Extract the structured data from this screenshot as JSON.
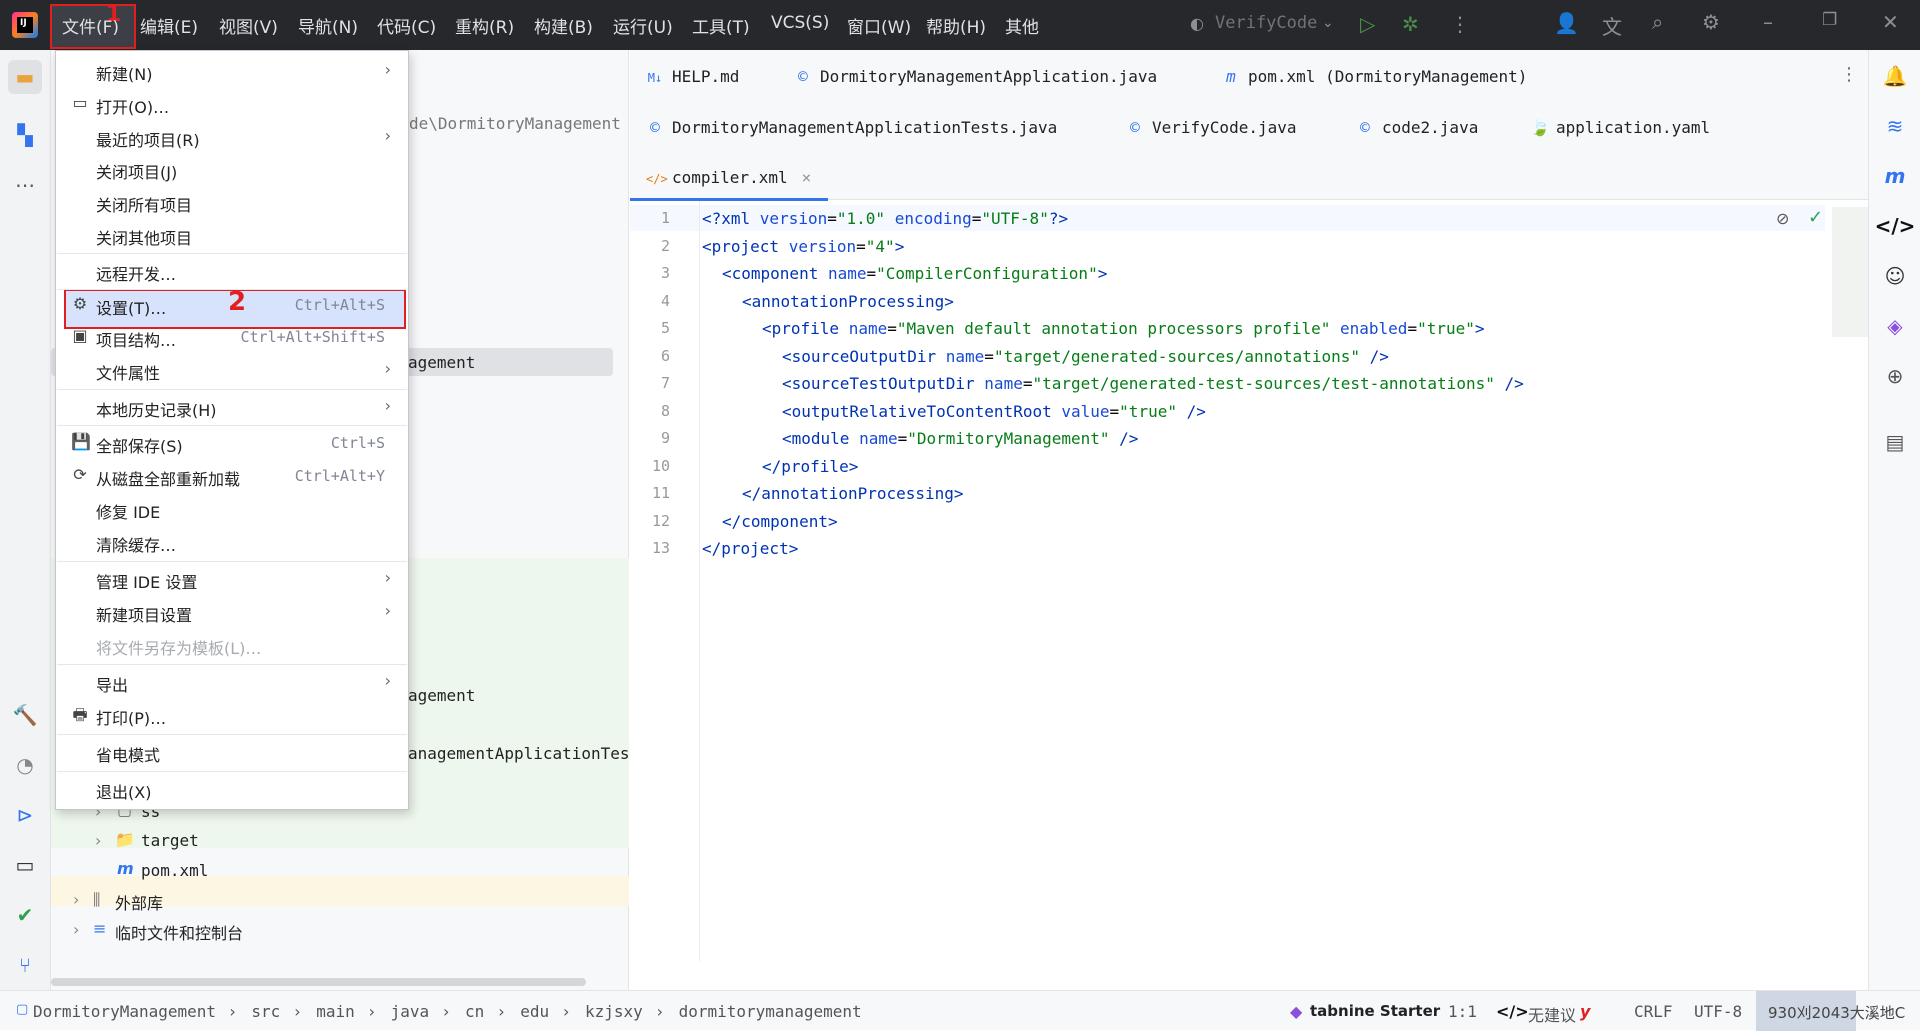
{
  "titlebar": {
    "menu": [
      "文件(F)",
      "编辑(E)",
      "视图(V)",
      "导航(N)",
      "代码(C)",
      "重构(R)",
      "构建(B)",
      "运行(U)",
      "工具(T)",
      "VCS(S)",
      "窗口(W)",
      "帮助(H)",
      "其他"
    ],
    "run_config": "VerifyCode",
    "annotation_1": "1"
  },
  "file_menu": {
    "annotation_2": "2",
    "items": [
      {
        "label": "新建(N)",
        "shortcut": "",
        "submenu": "›",
        "icon": ""
      },
      {
        "label": "打开(O)…",
        "shortcut": "",
        "submenu": "",
        "icon": "▭"
      },
      {
        "label": "最近的项目(R)",
        "shortcut": "",
        "submenu": "›",
        "icon": ""
      },
      {
        "label": "关闭项目(J)",
        "shortcut": "",
        "submenu": "",
        "icon": ""
      },
      {
        "label": "关闭所有项目",
        "shortcut": "",
        "submenu": "",
        "icon": ""
      },
      {
        "label": "关闭其他项目",
        "shortcut": "",
        "submenu": "",
        "icon": ""
      },
      {
        "label": "远程开发…",
        "shortcut": "",
        "submenu": "",
        "icon": ""
      },
      {
        "label": "设置(T)…",
        "shortcut": "Ctrl+Alt+S",
        "submenu": "",
        "icon": "⚙"
      },
      {
        "label": "项目结构…",
        "shortcut": "Ctrl+Alt+Shift+S",
        "submenu": "",
        "icon": "▣"
      },
      {
        "label": "文件属性",
        "shortcut": "",
        "submenu": "›",
        "icon": ""
      },
      {
        "label": "本地历史记录(H)",
        "shortcut": "",
        "submenu": "›",
        "icon": ""
      },
      {
        "label": "全部保存(S)",
        "shortcut": "Ctrl+S",
        "submenu": "",
        "icon": "💾"
      },
      {
        "label": "从磁盘全部重新加载",
        "shortcut": "Ctrl+Alt+Y",
        "submenu": "",
        "icon": "⟳"
      },
      {
        "label": "修复 IDE",
        "shortcut": "",
        "submenu": "",
        "icon": ""
      },
      {
        "label": "清除缓存…",
        "shortcut": "",
        "submenu": "",
        "icon": ""
      },
      {
        "label": "管理 IDE 设置",
        "shortcut": "",
        "submenu": "›",
        "icon": ""
      },
      {
        "label": "新建项目设置",
        "shortcut": "",
        "submenu": "›",
        "icon": ""
      },
      {
        "label": "将文件另存为模板(L)…",
        "shortcut": "",
        "submenu": "",
        "icon": ""
      },
      {
        "label": "导出",
        "shortcut": "",
        "submenu": "›",
        "icon": ""
      },
      {
        "label": "打印(P)…",
        "shortcut": "",
        "submenu": "",
        "icon": "🖶"
      },
      {
        "label": "省电模式",
        "shortcut": "",
        "submenu": "",
        "icon": ""
      },
      {
        "label": "退出(X)",
        "shortcut": "",
        "submenu": "",
        "icon": ""
      }
    ]
  },
  "project": {
    "path_fragment": "de\\DormitoryManagement",
    "hl_row": "agement",
    "row_agement2": "agement",
    "row_tests": "anagementApplicationTes",
    "tree": [
      {
        "label": "ss",
        "icon": "▢"
      },
      {
        "label": "target",
        "icon": "📁"
      },
      {
        "label": "pom.xml",
        "icon": "m"
      },
      {
        "label": "外部库",
        "icon": "⫼"
      },
      {
        "label": "临时文件和控制台",
        "icon": "≡"
      }
    ]
  },
  "editor": {
    "tabs_row1": [
      {
        "label": "HELP.md",
        "icon": "M↓"
      },
      {
        "label": "DormitoryManagementApplication.java",
        "icon": "©"
      },
      {
        "label": "pom.xml (DormitoryManagement)",
        "icon": "m"
      }
    ],
    "tabs_row2": [
      {
        "label": "DormitoryManagementApplicationTests.java",
        "icon": "©"
      },
      {
        "label": "VerifyCode.java",
        "icon": "©"
      },
      {
        "label": "code2.java",
        "icon": "©"
      },
      {
        "label": "application.yaml",
        "icon": "🍃"
      }
    ],
    "active_tab": {
      "label": "compiler.xml",
      "icon": "</>",
      "close": "×"
    },
    "line_numbers": [
      "1",
      "2",
      "3",
      "4",
      "5",
      "6",
      "7",
      "8",
      "9",
      "10",
      "11",
      "12",
      "13"
    ]
  },
  "statusbar": {
    "breadcrumb": [
      "DormitoryManagement",
      "src",
      "main",
      "java",
      "cn",
      "edu",
      "kzjsxy",
      "dormitorymanagement"
    ],
    "separator": "›",
    "tabnine": "tabnine Starter",
    "position": "1:1",
    "suggestion": "无建议",
    "line_sep": "CRLF",
    "encoding": "UTF-8",
    "extra": "930刈2043大溪地C"
  },
  "colors": {
    "accent": "#3574f0",
    "highlight_red": "#e02020",
    "titlebar": "#27282c"
  }
}
